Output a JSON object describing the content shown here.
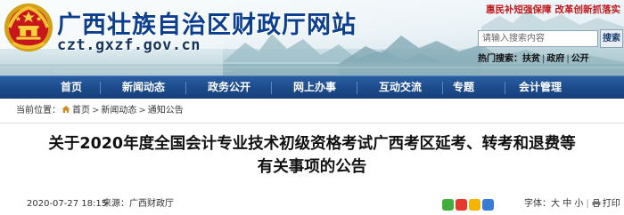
{
  "header": {
    "site_title": "广西壮族自治区财政厅网站",
    "site_domain": "czt.gxzf.gov.cn",
    "slogans": [
      "惠民补短强保障",
      "改革创新抓落实"
    ],
    "search_placeholder": "请输入搜索内容",
    "search_button": "搜索",
    "hot_label": "热门搜索：",
    "hot_words": [
      "扶贫",
      "政府",
      "公开"
    ]
  },
  "nav": {
    "items": [
      "首页",
      "新闻动态",
      "政务公开",
      "网上办事",
      "互动交流",
      "专题",
      "会计管理"
    ]
  },
  "breadcrumb": {
    "prefix": "当前位置：",
    "items": [
      "首页",
      "新闻动态",
      "通知公告"
    ]
  },
  "article": {
    "title_line1": "关于2020年度全国会计专业技术初级资格考试广西考区延考、转考和退费等",
    "title_line2": "有关事项的公告",
    "date": "2020-07-27 18:15",
    "source": "来源：广西财政厅",
    "font_size_label": "字体：",
    "font_sizes": [
      "大",
      "中",
      "小"
    ],
    "print_label": "打印"
  },
  "colors": {
    "brand_blue": "#0b3f8e",
    "nav_blue": "#1d4c8c",
    "slogan_red": "#c0181d"
  },
  "icons": {
    "emblem": "national-emblem-icon",
    "home": "home-icon",
    "share": [
      "share-wechat-icon",
      "share-weibo-icon",
      "share-qzone-icon",
      "share-more-icon"
    ],
    "print": "print-icon"
  }
}
